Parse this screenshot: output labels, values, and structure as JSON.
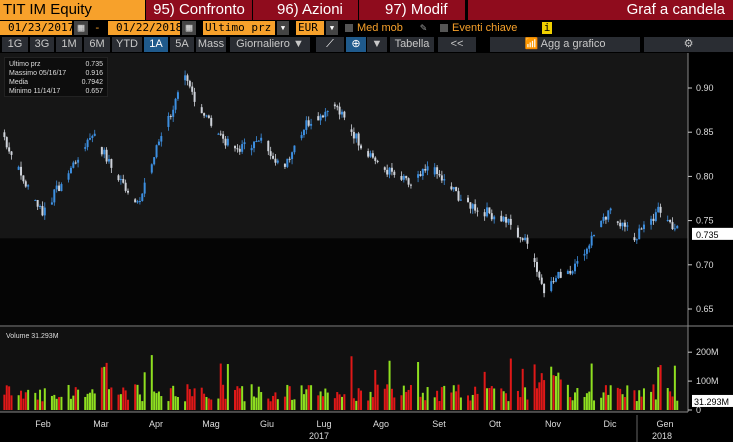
{
  "header": {
    "ticker": "TIT IM Equity",
    "btn1": "95) Confronto",
    "btn2": "96) Azioni",
    "btn3": "97) Modif",
    "title": "Graf a candela"
  },
  "controls": {
    "start_date": "01/23/2017",
    "sep": "-",
    "end_date": "01/22/2018",
    "field": "Ultimo prz",
    "currency": "EUR",
    "moving_avg": "Med mob",
    "key_events": "Eventi chiave",
    "info": "i"
  },
  "toolbar": {
    "periods": [
      "1G",
      "3G",
      "1M",
      "6M",
      "YTD",
      "1A",
      "5A",
      "Mass"
    ],
    "selected": "1A",
    "frequency": "Giornaliero",
    "table": "Tabella",
    "back": "<<",
    "add_chart": "Agg a grafico"
  },
  "legend": [
    {
      "label": "Ultimo prz",
      "value": "0.735"
    },
    {
      "label": "Massimo 05/16/17",
      "value": "0.916"
    },
    {
      "label": "Media",
      "value": "0.7942"
    },
    {
      "label": "Minimo 11/14/17",
      "value": "0.657"
    }
  ],
  "volume_label": "Volume 31.293M",
  "colors": {
    "up": "#3d8fe0",
    "down": "#cfd3da",
    "vol_up": "#8fe020",
    "vol_down": "#e01818",
    "accent": "#f7a12b"
  },
  "chart_data": {
    "type": "candlestick",
    "price_axis": {
      "ticks": [
        "0.90",
        "0.85",
        "0.80",
        "0.75",
        "0.70",
        "0.65"
      ],
      "range": [
        0.63,
        0.935
      ],
      "last": "0.735"
    },
    "volume_axis": {
      "ticks": [
        "200M",
        "100M",
        "0"
      ],
      "range": [
        0,
        240
      ],
      "last": "31.293M"
    },
    "months": [
      "Feb",
      "Mar",
      "Apr",
      "Mag",
      "Giu",
      "Lug",
      "Ago",
      "Set",
      "Ott",
      "Nov",
      "Dic",
      "Gen"
    ],
    "years": [
      "2017",
      "2018"
    ],
    "close_keypoints": [
      [
        0,
        0.85
      ],
      [
        8,
        0.8
      ],
      [
        17,
        0.76
      ],
      [
        27,
        0.8
      ],
      [
        38,
        0.85
      ],
      [
        48,
        0.8
      ],
      [
        58,
        0.77
      ],
      [
        66,
        0.84
      ],
      [
        77,
        0.91
      ],
      [
        85,
        0.87
      ],
      [
        97,
        0.83
      ],
      [
        110,
        0.84
      ],
      [
        118,
        0.81
      ],
      [
        128,
        0.86
      ],
      [
        140,
        0.88
      ],
      [
        150,
        0.84
      ],
      [
        160,
        0.81
      ],
      [
        172,
        0.79
      ],
      [
        180,
        0.81
      ],
      [
        195,
        0.77
      ],
      [
        212,
        0.75
      ],
      [
        222,
        0.72
      ],
      [
        228,
        0.67
      ],
      [
        235,
        0.69
      ],
      [
        242,
        0.7
      ],
      [
        248,
        0.73
      ],
      [
        256,
        0.76
      ],
      [
        266,
        0.73
      ],
      [
        276,
        0.76
      ],
      [
        286,
        0.735
      ]
    ]
  }
}
